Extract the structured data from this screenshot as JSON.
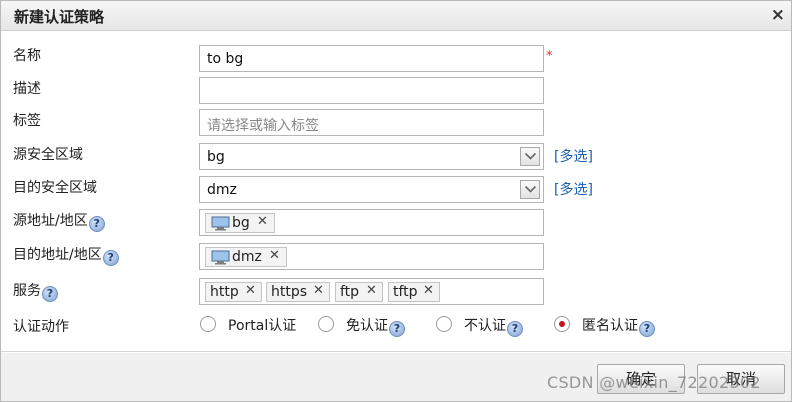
{
  "dialog": {
    "title": "新建认证策略",
    "close_glyph": "×"
  },
  "form": {
    "name": {
      "label": "名称",
      "value": "to bg",
      "required_mark": "*"
    },
    "description": {
      "label": "描述",
      "value": ""
    },
    "tags": {
      "label": "标签",
      "placeholder": "请选择或输入标签"
    },
    "source_zone": {
      "label": "源安全区域",
      "value": "bg",
      "multi_link": "[多选]"
    },
    "dest_zone": {
      "label": "目的安全区域",
      "value": "dmz",
      "multi_link": "[多选]"
    },
    "source_addr": {
      "label": "源地址/地区",
      "help": "?",
      "tags": [
        "bg"
      ]
    },
    "dest_addr": {
      "label": "目的地址/地区",
      "help": "?",
      "tags": [
        "dmz"
      ]
    },
    "service": {
      "label": "服务",
      "help": "?",
      "tags": [
        "http",
        "https",
        "ftp",
        "tftp"
      ]
    },
    "auth_action": {
      "label": "认证动作",
      "options": [
        {
          "label": "Portal认证",
          "checked": false,
          "help": ""
        },
        {
          "label": "免认证",
          "checked": false,
          "help": "?"
        },
        {
          "label": "不认证",
          "checked": false,
          "help": "?"
        },
        {
          "label": "匿名认证",
          "checked": true,
          "help": "?"
        }
      ]
    },
    "tag_remove_glyph": "✕"
  },
  "footer": {
    "ok_label": "确定",
    "cancel_label": "取消"
  },
  "watermark": "CSDN @weixin_72202302",
  "colors": {
    "link": "#1a5fb4",
    "required": "#e03030",
    "radio_checked": "#c3161c"
  }
}
